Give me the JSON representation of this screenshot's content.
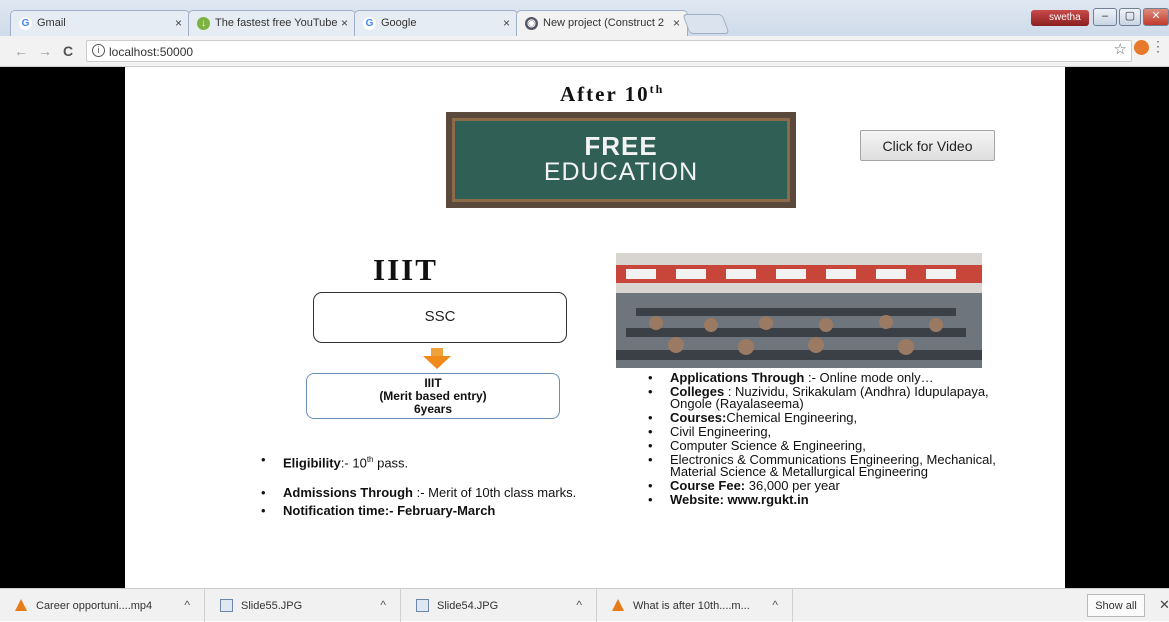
{
  "browser": {
    "tabs": [
      {
        "title": "Gmail",
        "icon": "gmail-icon"
      },
      {
        "title": "The fastest free YouTube",
        "icon": "download-icon"
      },
      {
        "title": "Google",
        "icon": "google-icon"
      },
      {
        "title": "New project (Construct 2",
        "icon": "construct-icon"
      }
    ],
    "user": "swetha",
    "url": "localhost:50000"
  },
  "slide": {
    "heading_main": "After 10",
    "heading_sup": "th",
    "banner_line1": "FREE",
    "banner_line2": "EDUCATION",
    "video_button": "Click for Video",
    "section_title": "IIIT",
    "ssc_box": "SSC",
    "merit_line1": "IIIT",
    "merit_line2": "(Merit based entry)",
    "merit_line3": "6years",
    "left_bullets": {
      "eligibility_label": "Eligibility",
      "eligibility_value": ":- 10",
      "eligibility_sup": "th",
      "eligibility_tail": " pass.",
      "admissions_label": "Admissions Through",
      "admissions_value": ":- Merit of 10th class marks.",
      "notification_label": "Notification time:-",
      "notification_value": "  February-March"
    },
    "right_bullets": {
      "applications_label": "Applications Through",
      "applications_value": ":-  Online mode only…",
      "colleges_label": "Colleges",
      "colleges_value": ":  Nuzividu, Srikakulam (Andhra) Idupulapaya, Ongole (Rayalaseema)",
      "courses_label": "Courses:",
      "courses_value": "Chemical Engineering,",
      "course_2": "Civil Engineering,",
      "course_3": "Computer Science & Engineering,",
      "course_4": "Electronics & Communications Engineering, Mechanical, Material Science & Metallurgical Engineering",
      "fee_label": "Course Fee:",
      "fee_value": " 36,000 per year",
      "website_label": "Website:",
      "website_value": "  www.rgukt.in"
    }
  },
  "downloads": [
    {
      "name": "Career opportuni....mp4",
      "icon": "vlc-icon"
    },
    {
      "name": "Slide55.JPG",
      "icon": "image-file-icon"
    },
    {
      "name": "Slide54.JPG",
      "icon": "image-file-icon"
    },
    {
      "name": "What is after 10th....m...",
      "icon": "vlc-icon"
    }
  ],
  "show_all": "Show all"
}
